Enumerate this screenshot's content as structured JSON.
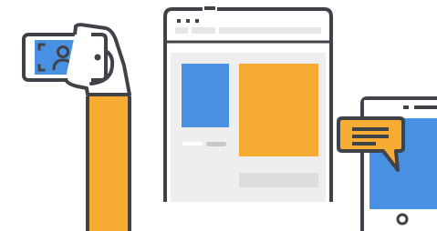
{
  "illustration": {
    "subject": "multi-device-content-sharing",
    "icons": {
      "photo_subject": "person-icon",
      "phone_home": "home-button-icon",
      "message": "chat-bubble-icon"
    },
    "colors": {
      "outline": "#3f4347",
      "blue": "#4a90e2",
      "orange": "#f6ab33",
      "light_gray": "#e6e6e6",
      "mid_gray": "#c8c8c8",
      "white": "#ffffff"
    }
  }
}
